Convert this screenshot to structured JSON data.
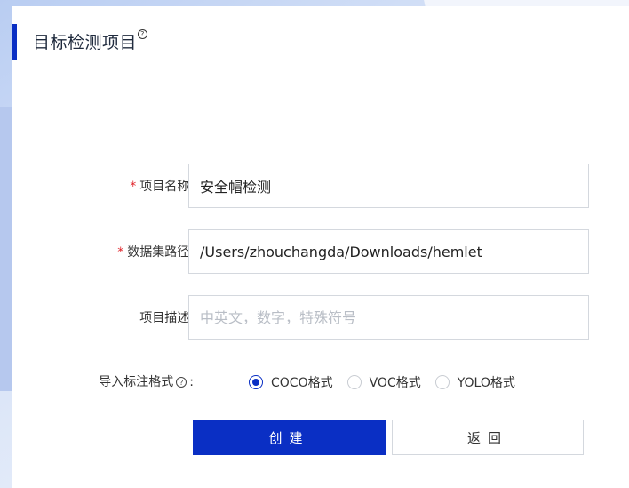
{
  "page": {
    "title": "目标检测项目",
    "help_mark": "?"
  },
  "form": {
    "name": {
      "required_mark": "*",
      "label": "项目名称:",
      "value": "安全帽检测"
    },
    "dataset_path": {
      "required_mark": "*",
      "label": "数据集路径:",
      "value": "/Users/zhouchangda/Downloads/hemlet"
    },
    "description": {
      "label": "项目描述:",
      "value": "",
      "placeholder": "中英文，数字，特殊符号"
    },
    "import_format": {
      "label": "导入标注格式",
      "help_mark": "?",
      "colon": ":",
      "options": [
        {
          "label": "COCO格式",
          "checked": true
        },
        {
          "label": "VOC格式",
          "checked": false
        },
        {
          "label": "YOLO格式",
          "checked": false
        }
      ]
    }
  },
  "buttons": {
    "create": "创建",
    "back": "返回"
  },
  "colors": {
    "accent": "#0a2fc4",
    "required": "#e0252b",
    "border": "#d4d8de"
  }
}
